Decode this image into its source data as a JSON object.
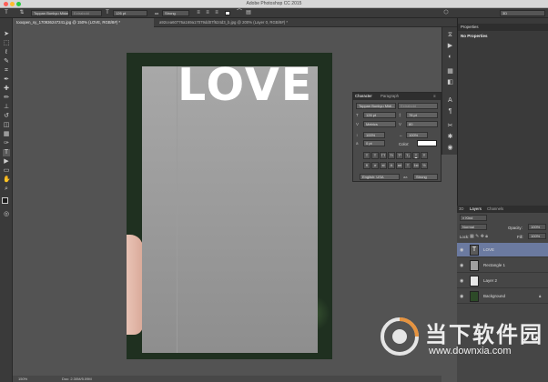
{
  "app": {
    "title": "Adobe Photoshop CC 2015"
  },
  "options_bar": {
    "font_family": "Toppan Bunkyu Midashi...",
    "font_style": "Extrabold",
    "font_size": "126 pt",
    "antialias": "Strong",
    "right_value": "3D"
  },
  "tabs": [
    {
      "label": "tooopen_sy_170936247241.jpg @ 150% (LOVE, RGB/8#) *"
    },
    {
      "label": "a92cea60776a169a17079dd07f624d3_b.jpg @ 200% (Layer 0, RGB/8#) *"
    }
  ],
  "canvas": {
    "text": "LOVE"
  },
  "properties_panel": {
    "title": "Properties",
    "message": "No Properties"
  },
  "character_panel": {
    "tab_character": "Character",
    "tab_paragraph": "Paragraph",
    "font_family": "Toppan Bunkyu Midi...",
    "font_style": "Extrabold",
    "font_size": "126 pt",
    "leading": "78 pt",
    "kerning": "Metrics",
    "tracking": "80",
    "vertical_scale": "100%",
    "horizontal_scale": "100%",
    "baseline_shift": "0 pt",
    "color_label": "Color:",
    "language": "English: USA",
    "antialias": "Strong",
    "type_buttons": [
      "T",
      "T",
      "TT",
      "Tt",
      "T¹",
      "T₁",
      "T",
      "Ŧ"
    ],
    "opentype_buttons": [
      "fi",
      "ơ",
      "st",
      "A",
      "ad",
      "T",
      "1st",
      "½"
    ]
  },
  "layers_panel": {
    "tabs": [
      "3D",
      "Layers",
      "Channels"
    ],
    "filter": "Kind",
    "blend_mode": "Normal",
    "opacity_label": "Opacity:",
    "opacity": "100%",
    "lock_label": "Lock:",
    "fill_label": "Fill:",
    "fill": "100%",
    "layers": [
      {
        "name": "LOVE",
        "type": "text",
        "selected": true
      },
      {
        "name": "Rectangle 1",
        "type": "shape",
        "selected": false
      },
      {
        "name": "Layer 2",
        "type": "pixel",
        "selected": false
      },
      {
        "name": "Background",
        "type": "background",
        "selected": false
      }
    ]
  },
  "status_bar": {
    "zoom": "150%",
    "doc": "Doc: 2.30M/5.09M"
  },
  "watermark": {
    "brand": "当下软件园",
    "url": "www.downxia.com"
  },
  "colors": {
    "accent_selected": "#6b7aa0",
    "foreground": "#1a1a1a",
    "background": "#3c4f8a"
  }
}
